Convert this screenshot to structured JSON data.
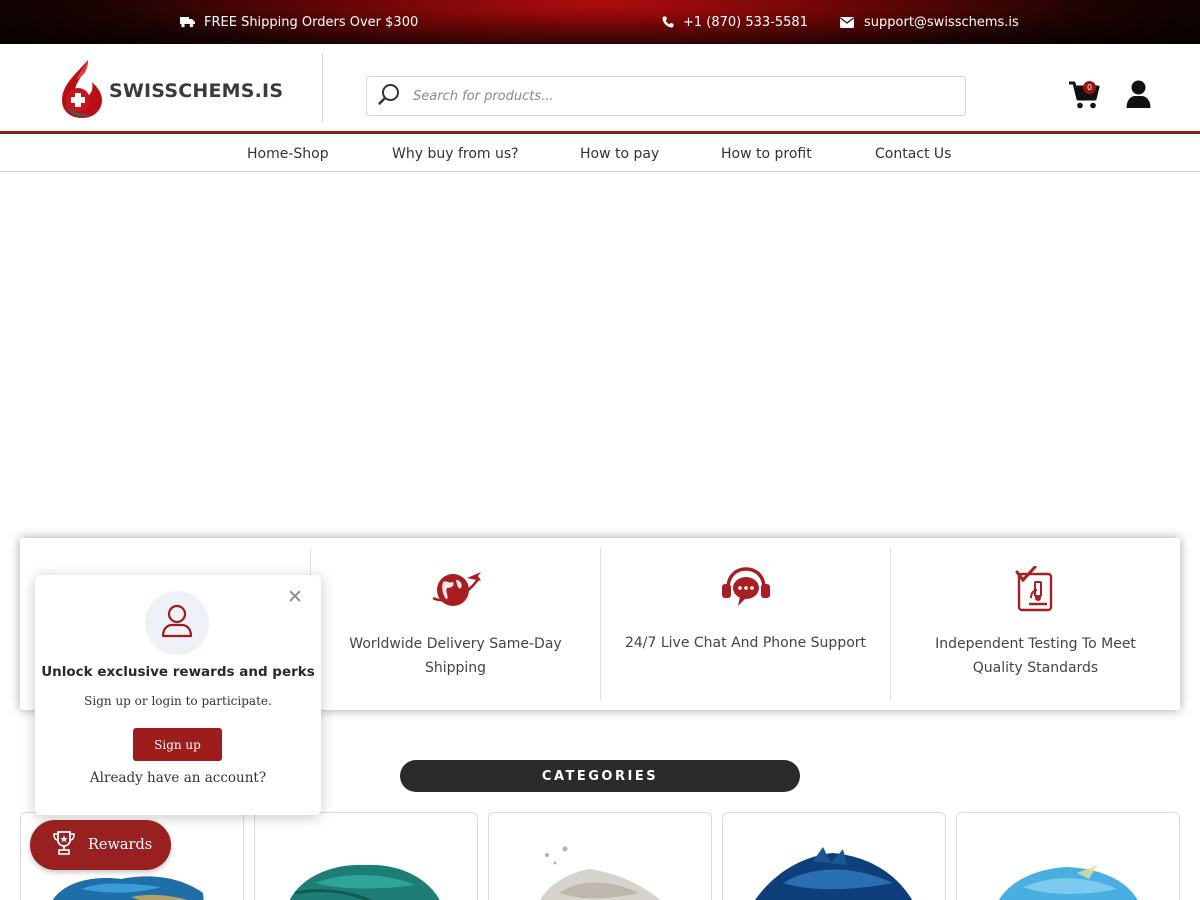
{
  "topbar": {
    "shipping_text": "FREE Shipping Orders Over $300",
    "phone": "+1 (870) 533-5581",
    "email": "support@swisschems.is",
    "icons": [
      "truck-icon",
      "phone-icon",
      "envelope-icon"
    ]
  },
  "header": {
    "logo_text": "SWISSCHEMS.IS",
    "search_placeholder": "Search for products...",
    "cart_count": "0"
  },
  "nav": {
    "items": [
      "Home-Shop",
      "Why buy from us?",
      "How to pay",
      "How to profit",
      "Contact Us"
    ]
  },
  "features": [
    {
      "icon": "worldwide-delivery-icon",
      "text": "Worldwide Delivery Same-Day Shipping"
    },
    {
      "icon": "live-chat-support-icon",
      "text": "24/7 Live Chat And Phone Support"
    },
    {
      "icon": "lab-testing-icon",
      "text": "Independent Testing To Meet Quality Standards"
    }
  ],
  "categories": {
    "title": "CATEGORIES"
  },
  "popup": {
    "title": "Unlock exclusive rewards and perks",
    "subtitle": "Sign up or login to participate.",
    "signup_label": "Sign up",
    "signin_text": "Already have an account?"
  },
  "rewards": {
    "label": "Rewards"
  },
  "colors": {
    "brand_red": "#9d1c1c",
    "dark_pill": "#2b2b2b"
  }
}
